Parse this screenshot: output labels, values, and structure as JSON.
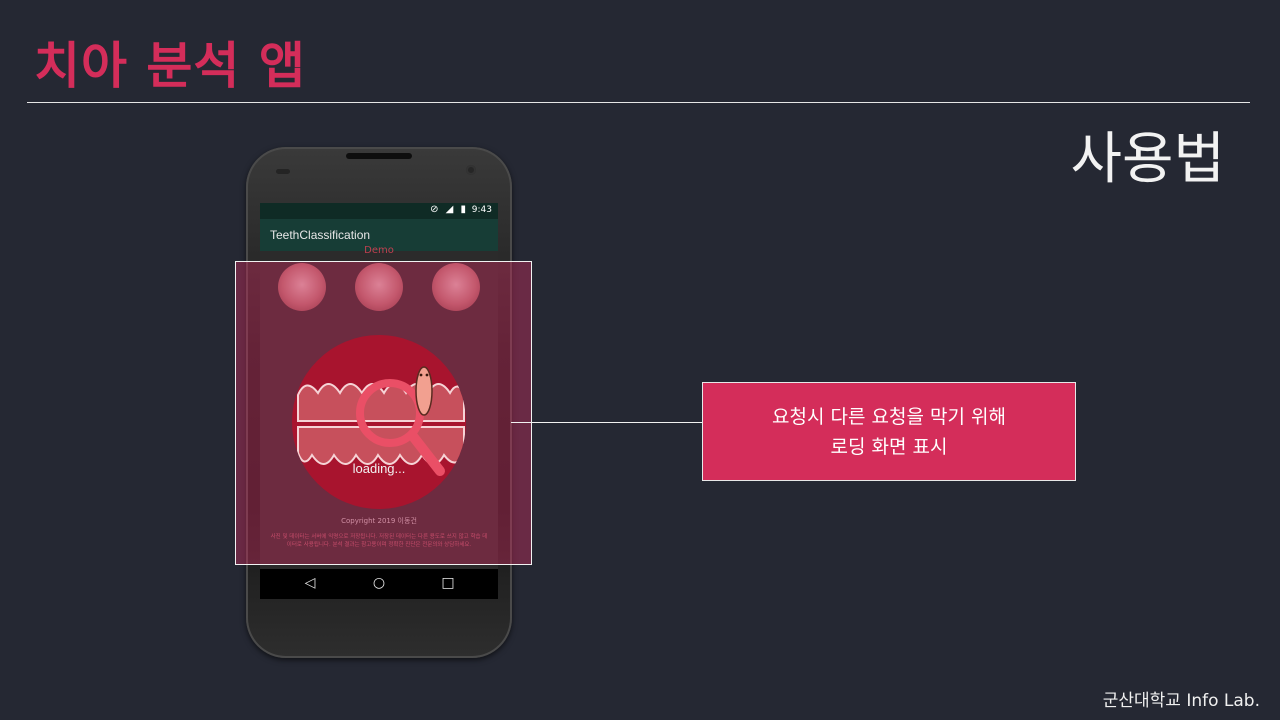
{
  "slide": {
    "title": "치아 분석 앱",
    "section": "사용법",
    "footer": "군산대학교 Info Lab."
  },
  "phone": {
    "status_time": "9:43",
    "status_icons": "⊘ ◢ ▮",
    "app_title": "TeethClassification",
    "demo_label": "Demo",
    "copyright": "Copyright 2019 이동건",
    "fine_text": "사진 및 데이터는 서버에 익명으로 저장됩니다. 저장된 데이터는 다른 용도로 쓰지 않고 학습 데이터로 사용됩니다. 분석 결과는 참고용이며 정확한 진단은 전문의와 상담하세요.",
    "loading_text": "loading...",
    "nav": {
      "back": "◁",
      "home": "○",
      "recent": "□"
    }
  },
  "callout": {
    "line1": "요청시 다른 요청을 막기 위해",
    "line2": "로딩 화면 표시"
  },
  "colors": {
    "background": "#252833",
    "accent": "#d42d5a",
    "app_bar": "#173d36",
    "loading_circle": "#a8142e"
  }
}
